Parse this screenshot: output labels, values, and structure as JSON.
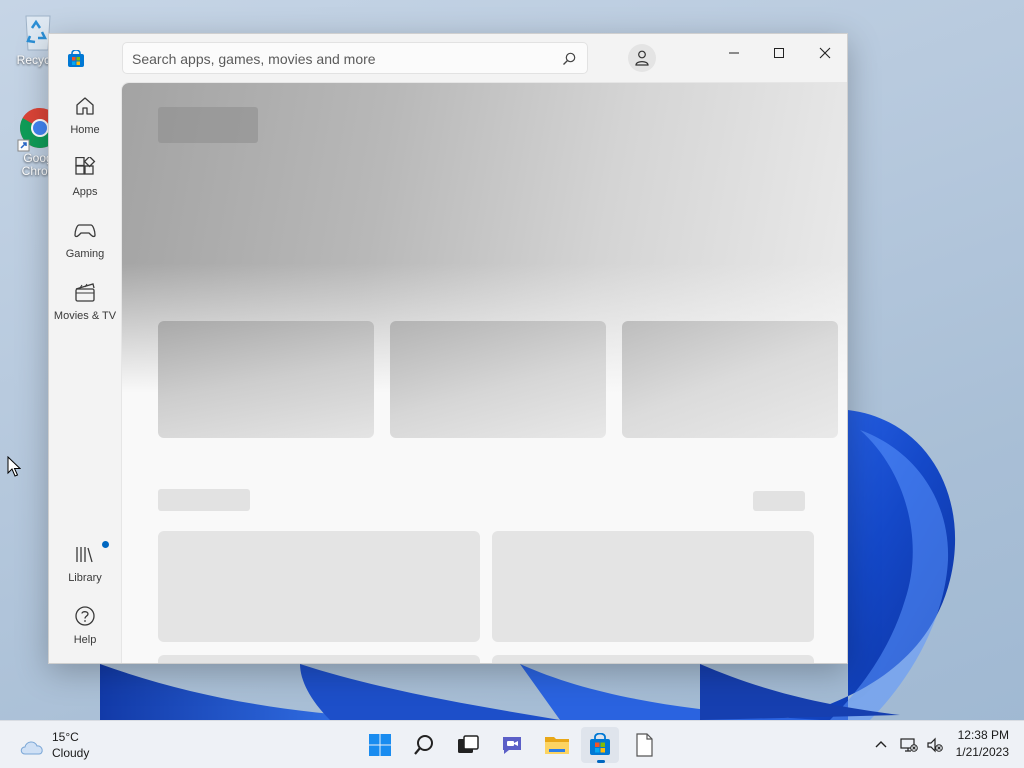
{
  "desktop": {
    "icons": [
      {
        "label": "Recycle"
      },
      {
        "label_line1": "Goog",
        "label_line2": "Chron"
      }
    ]
  },
  "store": {
    "search": {
      "placeholder": "Search apps, games, movies and more"
    },
    "nav": [
      {
        "label": "Home",
        "icon": "home-icon"
      },
      {
        "label": "Apps",
        "icon": "apps-icon"
      },
      {
        "label": "Gaming",
        "icon": "gamepad-icon"
      },
      {
        "label": "Movies & TV",
        "icon": "clapperboard-icon"
      }
    ],
    "nav_bottom": [
      {
        "label": "Library",
        "icon": "library-icon"
      },
      {
        "label": "Help",
        "icon": "help-icon"
      }
    ],
    "window_controls": [
      "minimize",
      "maximize",
      "close"
    ]
  },
  "taskbar": {
    "weather": {
      "temp": "15°C",
      "condition": "Cloudy"
    },
    "apps": [
      "start",
      "search",
      "task-view",
      "chat",
      "file-explorer",
      "microsoft-store",
      "notepad"
    ],
    "clock": {
      "time": "12:38 PM",
      "date": "1/21/2023"
    }
  },
  "colors": {
    "accent": "#0067c0",
    "store_blue": "#0078d4"
  }
}
